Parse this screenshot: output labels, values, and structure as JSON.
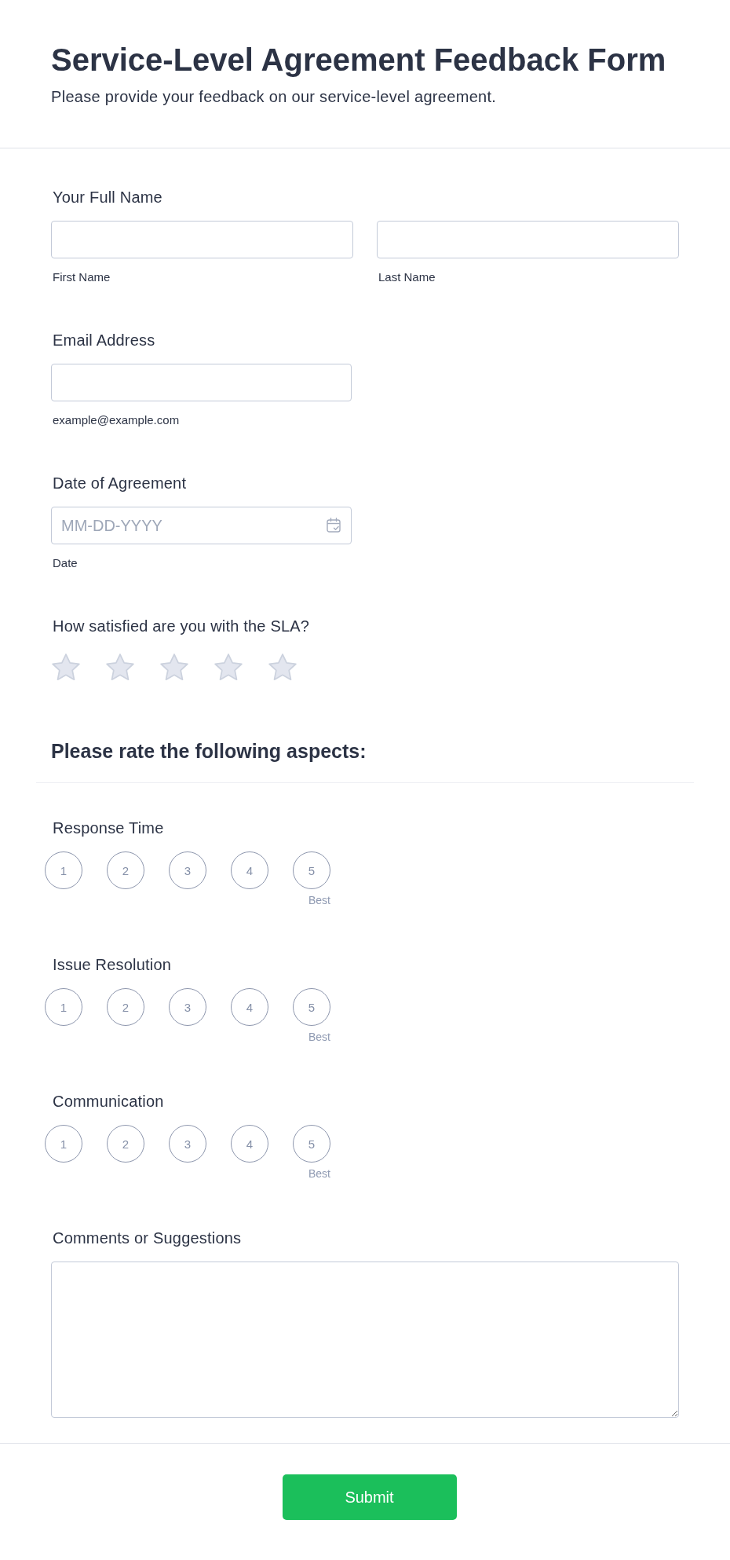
{
  "header": {
    "title": "Service-Level Agreement Feedback Form",
    "subtitle": "Please provide your feedback on our service-level agreement."
  },
  "full_name": {
    "label": "Your Full Name",
    "first_sublabel": "First Name",
    "last_sublabel": "Last Name"
  },
  "email": {
    "label": "Email Address",
    "sublabel": "example@example.com"
  },
  "date": {
    "label": "Date of Agreement",
    "placeholder": "MM-DD-YYYY",
    "sublabel": "Date"
  },
  "satisfaction": {
    "label": "How satisfied are you with the SLA?",
    "stars": 0
  },
  "ratings": {
    "heading": "Please rate the following aspects:",
    "rows": [
      {
        "label": "Response Time",
        "max_label": "Best",
        "options": [
          {
            "label": "1",
            "selected": false
          },
          {
            "label": "2",
            "selected": false
          },
          {
            "label": "3",
            "selected": false
          },
          {
            "label": "4",
            "selected": false
          },
          {
            "label": "5",
            "selected": false
          }
        ]
      },
      {
        "label": "Issue Resolution",
        "max_label": "Best",
        "options": [
          {
            "label": "1",
            "selected": false
          },
          {
            "label": "2",
            "selected": false
          },
          {
            "label": "3",
            "selected": false
          },
          {
            "label": "4",
            "selected": false
          },
          {
            "label": "5",
            "selected": false
          }
        ]
      },
      {
        "label": "Communication",
        "max_label": "Best",
        "options": [
          {
            "label": "1",
            "selected": false
          },
          {
            "label": "2",
            "selected": false
          },
          {
            "label": "3",
            "selected": false
          },
          {
            "label": "4",
            "selected": false
          },
          {
            "label": "5",
            "selected": false
          }
        ]
      }
    ]
  },
  "comments": {
    "label": "Comments or Suggestions"
  },
  "submit_button": {
    "label": "Submit"
  }
}
